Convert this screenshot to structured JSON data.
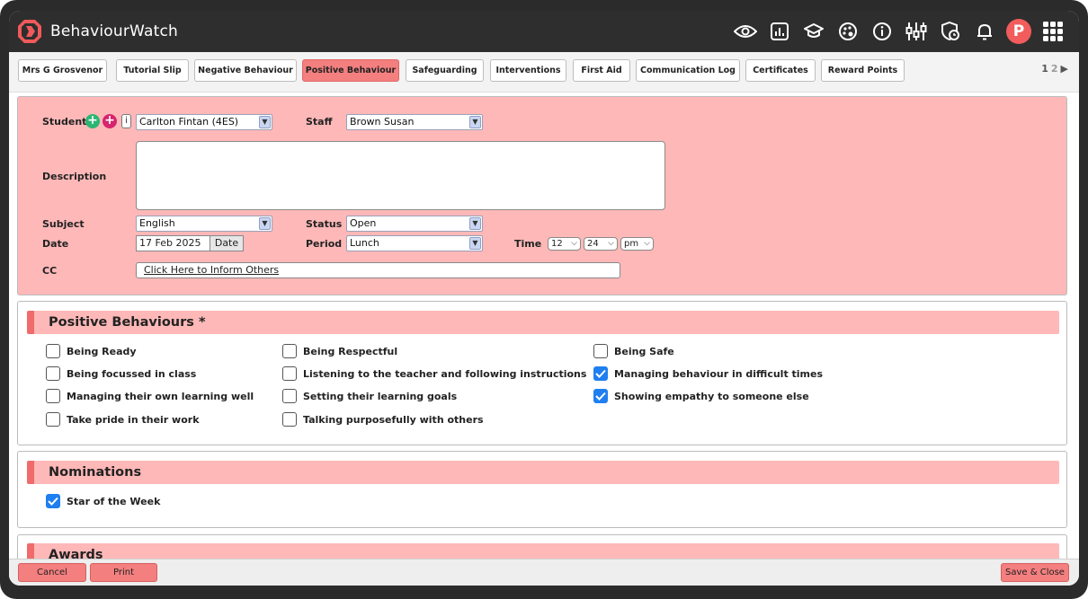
{
  "app": {
    "name": "BehaviourWatch"
  },
  "topbar": {
    "icons": [
      "eye-icon",
      "chart-icon",
      "graduation-cap-icon",
      "palette-icon",
      "info-icon",
      "sliders-icon",
      "shield-clock-icon",
      "bell-icon"
    ],
    "avatar_letter": "P",
    "apps_icon": "grid-icon"
  },
  "tabs": [
    {
      "label": "Mrs G Grosvenor"
    },
    {
      "label": "Tutorial Slip"
    },
    {
      "label": "Negative Behaviour"
    },
    {
      "label": "Positive Behaviour"
    },
    {
      "label": "Safeguarding"
    },
    {
      "label": "Interventions"
    },
    {
      "label": "First Aid"
    },
    {
      "label": "Communication Log"
    },
    {
      "label": "Certificates"
    },
    {
      "label": "Reward Points"
    }
  ],
  "pager": {
    "page1": "1",
    "page2": "2",
    "next": "▶"
  },
  "form": {
    "student_label": "Student",
    "student_value": "Carlton Fintan (4ES)",
    "staff_label": "Staff",
    "staff_value": "Brown Susan",
    "description_label": "Description",
    "description_value": "",
    "subject_label": "Subject",
    "subject_value": "English",
    "status_label": "Status",
    "status_value": "Open",
    "date_label": "Date",
    "date_value": "17 Feb 2025",
    "date_button": "Date",
    "period_label": "Period",
    "period_value": "Lunch",
    "time_label": "Time",
    "time_hour": "12",
    "time_minute": "24",
    "time_ampm": "pm",
    "cc_label": "CC",
    "cc_link": "Click Here to Inform Others"
  },
  "positive_behaviours": {
    "title": "Positive Behaviours *",
    "items": [
      {
        "label": "Being Ready",
        "checked": false
      },
      {
        "label": "Being focussed in class",
        "checked": false
      },
      {
        "label": "Managing their own learning well",
        "checked": false
      },
      {
        "label": "Take pride in their work",
        "checked": false
      },
      {
        "label": "Being Respectful",
        "checked": false
      },
      {
        "label": "Listening to the teacher and following instructions",
        "checked": false
      },
      {
        "label": "Setting their learning goals",
        "checked": false
      },
      {
        "label": "Talking purposefully with others",
        "checked": false
      },
      {
        "label": "Being Safe",
        "checked": false
      },
      {
        "label": "Managing behaviour in difficult times",
        "checked": true
      },
      {
        "label": "Showing empathy to someone else",
        "checked": true
      }
    ]
  },
  "nominations": {
    "title": "Nominations",
    "items": [
      {
        "label": "Star of the Week",
        "checked": true
      }
    ]
  },
  "awards": {
    "title": "Awards"
  },
  "footer": {
    "cancel": "Cancel",
    "print": "Print",
    "save_close": "Save & Close"
  },
  "colors": {
    "accent": "#f47f7f",
    "panel": "#ffb8b8",
    "check": "#1f7ff0",
    "topbar": "#2e2e2e"
  }
}
